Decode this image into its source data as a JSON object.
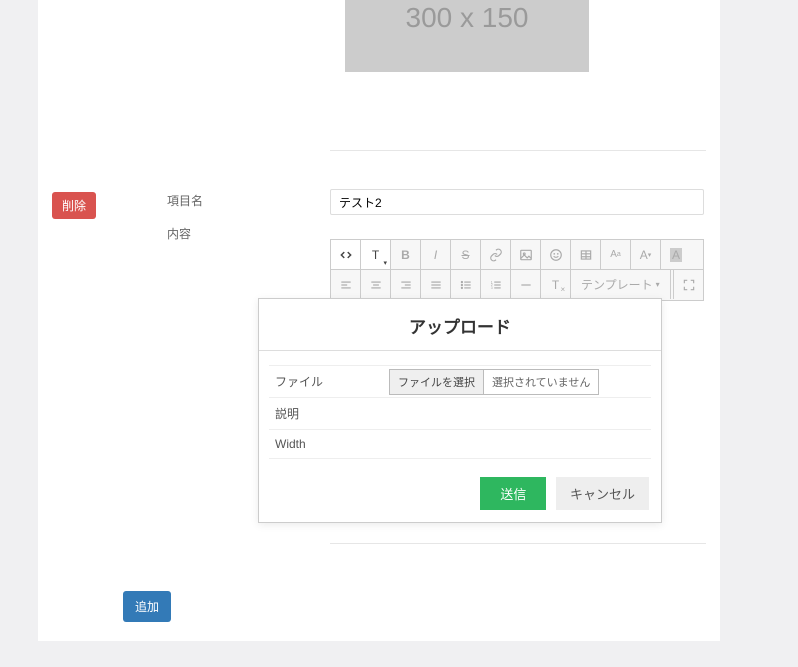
{
  "placeholder": {
    "text": "300 x 150"
  },
  "row2": {
    "delete_label": "削除",
    "field_name_label": "項目名",
    "field_name_value": "テスト2",
    "content_label": "内容"
  },
  "toolbar": {
    "template_label": "テンプレート",
    "icons": {
      "code": "code-icon",
      "text": "text-style-icon",
      "bold": "bold-icon",
      "italic": "italic-icon",
      "strike": "strike-icon",
      "link": "link-icon",
      "image": "image-icon",
      "smile": "emoji-icon",
      "table": "table-icon",
      "font_size": "font-size-icon",
      "font_family": "font-family-icon",
      "font_bg": "font-bg-icon",
      "align_left": "align-left-icon",
      "align_center": "align-center-icon",
      "align_right": "align-right-icon",
      "align_justify": "align-justify-icon",
      "list_ul": "ul-icon",
      "list_ol": "ol-icon",
      "hr": "hr-icon",
      "clear": "clear-format-icon",
      "fullscreen": "fullscreen-icon"
    }
  },
  "modal": {
    "title": "アップロード",
    "file_label": "ファイル",
    "file_button": "ファイルを選択",
    "file_status": "選択されていません",
    "desc_label": "説明",
    "width_label": "Width",
    "submit": "送信",
    "cancel": "キャンセル"
  },
  "add_label": "追加"
}
